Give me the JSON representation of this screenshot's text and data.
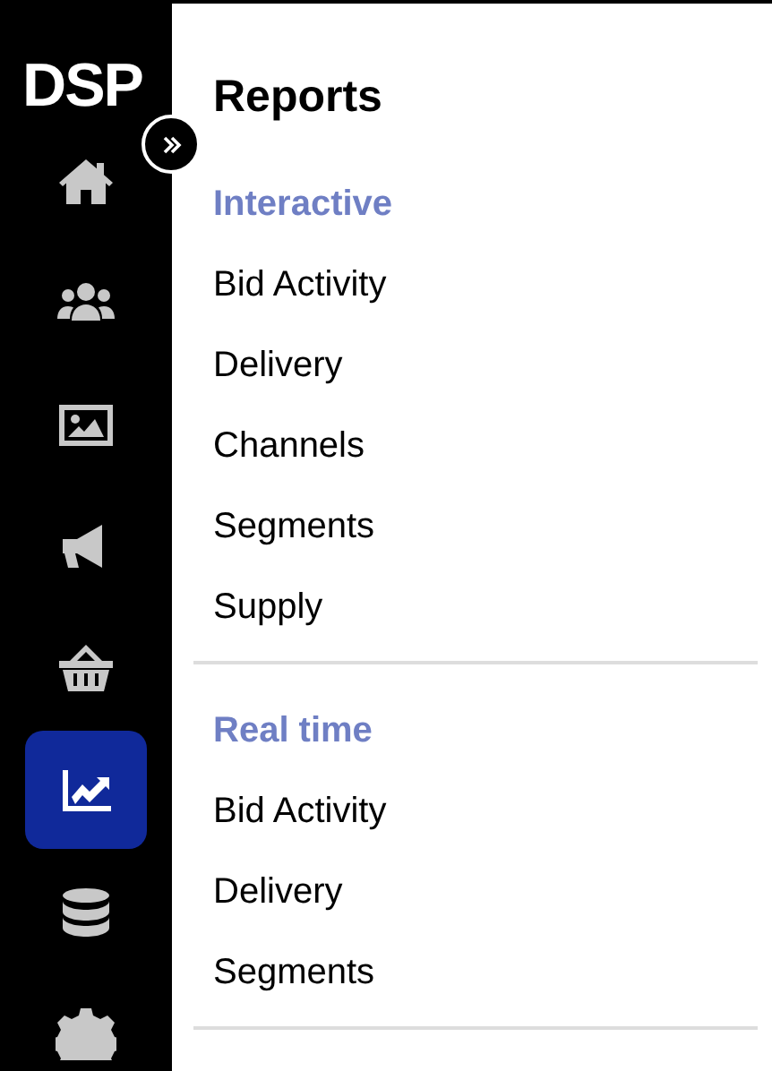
{
  "sidebar": {
    "logo": "DSP",
    "nav": [
      {
        "kind": "home",
        "selected": false
      },
      {
        "kind": "users",
        "selected": false
      },
      {
        "kind": "image",
        "selected": false
      },
      {
        "kind": "megaphone",
        "selected": false
      },
      {
        "kind": "basket",
        "selected": false
      },
      {
        "kind": "chart",
        "selected": true
      },
      {
        "kind": "database",
        "selected": false
      },
      {
        "kind": "gear",
        "selected": false
      }
    ]
  },
  "page": {
    "title": "Reports",
    "sections": [
      {
        "heading": "Interactive",
        "items": [
          "Bid Activity",
          "Delivery",
          "Channels",
          "Segments",
          "Supply"
        ]
      },
      {
        "heading": "Real time",
        "items": [
          "Bid Activity",
          "Delivery",
          "Segments"
        ]
      }
    ]
  }
}
